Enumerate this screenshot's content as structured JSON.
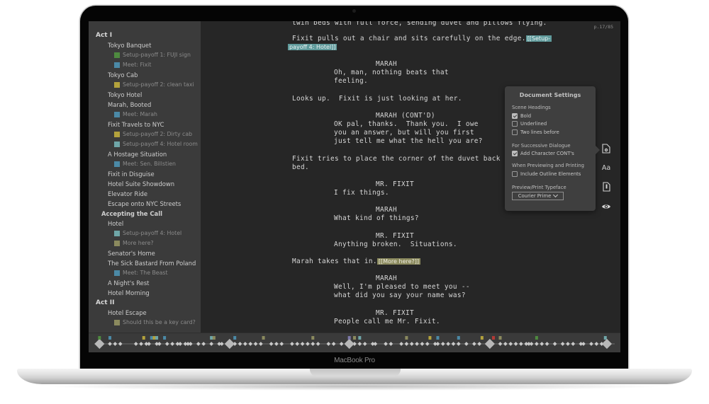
{
  "device": {
    "label": "MacBook Pro"
  },
  "outline": [
    {
      "kind": "act",
      "text": "Act I"
    },
    {
      "kind": "scene",
      "text": "Tokyo Banquet"
    },
    {
      "kind": "note",
      "text": "Setup-payoff 1: FUJI sign",
      "color": "#4e8a3f"
    },
    {
      "kind": "note",
      "text": "Meet: Fixit",
      "color": "#4b89a6"
    },
    {
      "kind": "scene",
      "text": "Tokyo Cab"
    },
    {
      "kind": "note",
      "text": "Setup-payoff 2: clean taxi",
      "color": "#b3a23c"
    },
    {
      "kind": "scene",
      "text": "Tokyo Hotel"
    },
    {
      "kind": "scene",
      "text": "Marah, Booted"
    },
    {
      "kind": "note",
      "text": "Meet: Marah",
      "color": "#4b89a6"
    },
    {
      "kind": "scene",
      "text": "Fixit Travels to NYC"
    },
    {
      "kind": "note",
      "text": "Setup-payoff 2: Dirty cab",
      "color": "#b3a23c"
    },
    {
      "kind": "note",
      "text": "Setup-payoff 4: Hotel room",
      "color": "#6fa6a8"
    },
    {
      "kind": "scene",
      "text": "A Hostage Situation"
    },
    {
      "kind": "note",
      "text": "Meet: Sen. Billstien",
      "color": "#4b89a6"
    },
    {
      "kind": "scene",
      "text": "Fixit in Disguise"
    },
    {
      "kind": "scene",
      "text": "Hotel Suite Showdown"
    },
    {
      "kind": "scene",
      "text": "Elevator Ride"
    },
    {
      "kind": "scene",
      "text": "Escape onto NYC Streets"
    },
    {
      "kind": "seq",
      "text": "Accepting the Call"
    },
    {
      "kind": "scene",
      "text": "Hotel"
    },
    {
      "kind": "note",
      "text": "Setup-payoff 4: Hotel",
      "color": "#6fa6a8"
    },
    {
      "kind": "note",
      "text": "More here?",
      "color": "#8b8a5e"
    },
    {
      "kind": "scene",
      "text": "Senator's Home"
    },
    {
      "kind": "scene",
      "text": "The Sick Bastard From Poland"
    },
    {
      "kind": "note",
      "text": "Meet: The Beast",
      "color": "#4b89a6"
    },
    {
      "kind": "scene",
      "text": "A Night's Rest"
    },
    {
      "kind": "scene",
      "text": "Hotel Morning"
    },
    {
      "kind": "act",
      "text": "Act II"
    },
    {
      "kind": "scene",
      "text": "Hotel Escape"
    },
    {
      "kind": "note",
      "text": "Should this be a key card?",
      "color": "#8b8a5e"
    }
  ],
  "editor": {
    "page_indicator": "p.17/85",
    "lines": [
      {
        "type": "action",
        "text": "twin beds with full force, sending duvet and pillows flying."
      },
      {
        "type": "action",
        "text": "Fixit pulls out a chair and sits carefully on the edge.",
        "tag": "[[Setup-",
        "tag_color": "teal"
      },
      {
        "type": "tagcont",
        "text": "payoff 4: Hotel]]",
        "tag_color": "teal"
      },
      {
        "type": "character",
        "text": "MARAH"
      },
      {
        "type": "dialogue",
        "text": "Oh, man, nothing beats that"
      },
      {
        "type": "dialogue",
        "text": "feeling."
      },
      {
        "type": "action",
        "text": "Looks up.  Fixit is just looking at her."
      },
      {
        "type": "character",
        "text": "MARAH (CONT'D)"
      },
      {
        "type": "dialogue",
        "text": "OK pal, thanks.  Thank you.  I owe"
      },
      {
        "type": "dialogue",
        "text": "you an answer, but will you first"
      },
      {
        "type": "dialogue",
        "text": "just tell me what the hell you are?"
      },
      {
        "type": "action",
        "text": "Fixit tries to place the corner of the duvet back on the"
      },
      {
        "type": "action",
        "text": "bed."
      },
      {
        "type": "character",
        "text": "MR. FIXIT"
      },
      {
        "type": "dialogue",
        "text": "I fix things."
      },
      {
        "type": "character",
        "text": "MARAH"
      },
      {
        "type": "dialogue",
        "text": "What kind of things?"
      },
      {
        "type": "character",
        "text": "MR. FIXIT"
      },
      {
        "type": "dialogue",
        "text": "Anything broken.  Situations."
      },
      {
        "type": "action",
        "text": "Marah takes that in.",
        "tag": "[[More here?]]",
        "tag_color": "olive"
      },
      {
        "type": "character",
        "text": "MARAH"
      },
      {
        "type": "dialogue",
        "text": "Well, I'm pleased to meet you --"
      },
      {
        "type": "dialogue",
        "text": "what did you say your name was?"
      },
      {
        "type": "character",
        "text": "MR. FIXIT"
      },
      {
        "type": "dialogue",
        "text": "People call me Mr. Fixit."
      }
    ]
  },
  "document_settings": {
    "title": "Document Settings",
    "scene_headings_label": "Scene Headings",
    "bold": {
      "label": "Bold",
      "checked": true
    },
    "underlined": {
      "label": "Underlined",
      "checked": false
    },
    "two_lines_before": {
      "label": "Two lines before",
      "checked": false
    },
    "successive_dialogue_label": "For Successive Dialogue",
    "add_contd": {
      "label": "Add Character CONT's",
      "checked": true
    },
    "previewing_label": "When Previewing and Printing",
    "include_outline": {
      "label": "Include Outline Elements",
      "checked": false
    },
    "typeface_label": "Preview/Print Typeface",
    "typeface_value": "Courier Prime"
  },
  "toolstrip": [
    {
      "name": "document-settings-icon",
      "glyph": "doc-gear",
      "active": true
    },
    {
      "name": "font-size-icon",
      "glyph": "Aa"
    },
    {
      "name": "page-break-icon",
      "glyph": "doc-bookmark"
    },
    {
      "name": "preview-eye-icon",
      "glyph": "eye"
    }
  ],
  "colors": {
    "teal_tag": "#5f9a9b",
    "olive_tag": "#8b8a5e",
    "green": "#4e8a3f",
    "blue": "#4b89a6",
    "yellow": "#b3a23c",
    "red": "#b23a36",
    "purple": "#7c78a8"
  },
  "timeline": {
    "act_markers": [
      0.01,
      0.26,
      0.49,
      0.76,
      0.985
    ],
    "scene_markers": [
      0.03,
      0.04,
      0.05,
      0.08,
      0.09,
      0.1,
      0.105,
      0.12,
      0.125,
      0.14,
      0.15,
      0.16,
      0.165,
      0.175,
      0.18,
      0.185,
      0.2,
      0.21,
      0.225,
      0.24,
      0.245,
      0.27,
      0.28,
      0.29,
      0.3,
      0.31,
      0.32,
      0.34,
      0.35,
      0.36,
      0.38,
      0.39,
      0.4,
      0.41,
      0.42,
      0.43,
      0.45,
      0.46,
      0.475,
      0.5,
      0.51,
      0.52,
      0.535,
      0.54,
      0.56,
      0.57,
      0.59,
      0.6,
      0.61,
      0.62,
      0.63,
      0.64,
      0.655,
      0.66,
      0.67,
      0.68,
      0.69,
      0.7,
      0.715,
      0.73,
      0.74,
      0.78,
      0.79,
      0.8,
      0.81,
      0.82,
      0.83,
      0.835,
      0.84,
      0.85,
      0.86,
      0.87,
      0.885,
      0.9,
      0.91,
      0.92,
      0.935,
      0.94,
      0.955,
      0.965,
      0.975
    ],
    "note_markers": [
      {
        "pos": 0.01,
        "color": "#4e8a3f"
      },
      {
        "pos": 0.03,
        "color": "#4b89a6"
      },
      {
        "pos": 0.095,
        "color": "#b3a23c"
      },
      {
        "pos": 0.11,
        "color": "#4b89a6"
      },
      {
        "pos": 0.115,
        "color": "#b3a23c"
      },
      {
        "pos": 0.12,
        "color": "#6fa6a8"
      },
      {
        "pos": 0.135,
        "color": "#4b89a6"
      },
      {
        "pos": 0.225,
        "color": "#6fa6a8"
      },
      {
        "pos": 0.23,
        "color": "#8b8a5e"
      },
      {
        "pos": 0.27,
        "color": "#4b89a6"
      },
      {
        "pos": 0.325,
        "color": "#8b8a5e"
      },
      {
        "pos": 0.42,
        "color": "#8b8a5e"
      },
      {
        "pos": 0.49,
        "color": "#7c78a8"
      },
      {
        "pos": 0.5,
        "color": "#8b8a5e"
      },
      {
        "pos": 0.51,
        "color": "#6fa6a8"
      },
      {
        "pos": 0.6,
        "color": "#8b8a5e"
      },
      {
        "pos": 0.645,
        "color": "#b3a23c"
      },
      {
        "pos": 0.66,
        "color": "#4b89a6"
      },
      {
        "pos": 0.7,
        "color": "#4b89a6"
      },
      {
        "pos": 0.745,
        "color": "#b3a23c"
      },
      {
        "pos": 0.767,
        "color": "#b23a36"
      },
      {
        "pos": 0.78,
        "color": "#8b8a5e"
      },
      {
        "pos": 0.85,
        "color": "#4e8a3f"
      },
      {
        "pos": 0.982,
        "color": "#6fa6a8"
      }
    ]
  }
}
